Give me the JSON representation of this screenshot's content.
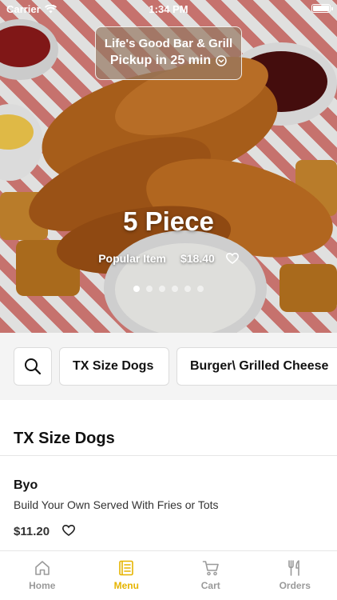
{
  "status_bar": {
    "carrier": "Carrier",
    "time": "1:34 PM"
  },
  "store": {
    "name": "Life's Good Bar & Grill",
    "pickup": "Pickup in 25 min"
  },
  "hero": {
    "title": "5 Piece",
    "tag": "Popular Item",
    "price": "$18.40",
    "slide_count": 6,
    "active_slide": 1
  },
  "categories": {
    "items": [
      {
        "label": "TX Size Dogs"
      },
      {
        "label": "Burger\\ Grilled Cheese"
      }
    ]
  },
  "section": {
    "title": "TX Size Dogs",
    "items": [
      {
        "name": "Byo",
        "description": "Build Your Own Served With Fries or Tots",
        "price": "$11.20"
      }
    ]
  },
  "tabs": [
    {
      "label": "Home",
      "icon": "home-icon",
      "active": false
    },
    {
      "label": "Menu",
      "icon": "menu-icon",
      "active": true
    },
    {
      "label": "Cart",
      "icon": "cart-icon",
      "active": false
    },
    {
      "label": "Orders",
      "icon": "orders-icon",
      "active": false
    }
  ],
  "colors": {
    "accent": "#e6b400",
    "inactive": "#9a9a9a",
    "sauce_red": "#c62828"
  }
}
